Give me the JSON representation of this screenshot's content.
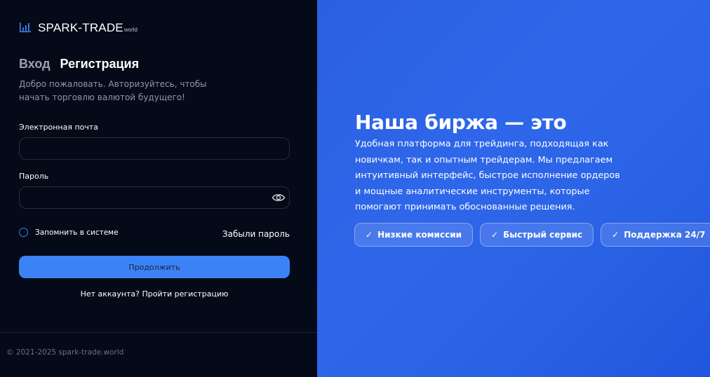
{
  "logo": {
    "icon": "bar-chart-icon",
    "main": "SPARK-TRADE",
    "sub": "world"
  },
  "auth": {
    "tabs": [
      {
        "label": "Вход",
        "active": false
      },
      {
        "label": "Регистрация",
        "active": true
      }
    ],
    "welcome": "Добро пожаловать. Авторизуйтесь, чтобы начать торговлю валютой будущего!",
    "email_label": "Электронная почта",
    "email_value": "",
    "email_placeholder": "",
    "password_label": "Пароль",
    "password_value": "",
    "password_placeholder": "",
    "password_toggle_icon": "eye-icon",
    "remember_label": "Запомнить в системе",
    "forgot_label": "Забыли пароль",
    "submit_label": "Продолжить",
    "signup_text": "Нет аккаунта? Пройти регистрацию"
  },
  "footer": {
    "copyright": "© 2021-2025 spark-trade.world"
  },
  "promo": {
    "headline": "Наша биржа — это",
    "description": "Удобная платформа для трейдинга, подходящая как новичкам, так и опытным трейдерам. Мы предлагаем интуитивный интерфейс, быстрое исполнение ордеров и мощные аналитические инструменты, которые помогают принимать обоснованные решения.",
    "badges": [
      {
        "label": "Низкие комиссии",
        "icon": "checkmark-icon"
      },
      {
        "label": "Быстрый сервис",
        "icon": "checkmark-icon"
      },
      {
        "label": "Поддержка 24/7",
        "icon": "checkmark-icon"
      }
    ]
  },
  "colors": {
    "left_bg": "#050a18",
    "right_bg": "#2f67ea",
    "accent": "#3b82f6",
    "muted_text": "#8f97a7"
  }
}
